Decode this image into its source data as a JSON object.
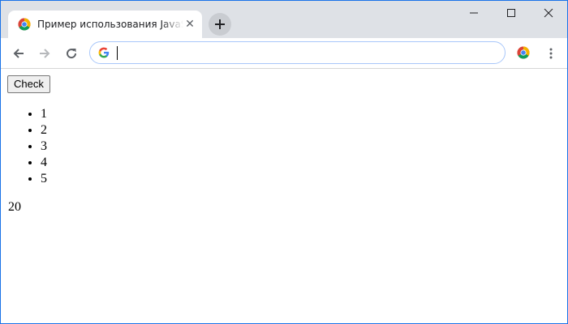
{
  "browser": {
    "tab": {
      "title": "Пример использования JavaScript",
      "favicon": "chrome-icon",
      "close_glyph": "✕"
    },
    "new_tab_glyph": "+",
    "window_controls": [
      "minimize-icon",
      "maximize-icon",
      "close-icon"
    ],
    "toolbar": {
      "back_icon": "arrow-left-icon",
      "forward_icon": "arrow-right-icon",
      "reload_icon": "reload-icon",
      "omnibox_value": "",
      "omnibox_icon": "google-g-icon",
      "extension_icon": "chrome-icon",
      "menu_icon": "kebab-menu-icon"
    },
    "colors": {
      "tabstrip": "#dee1e6",
      "accent": "#1a73e8",
      "omnibox_border": "#a8c7fa"
    }
  },
  "page": {
    "check_button_label": "Check",
    "list_items": [
      "1",
      "2",
      "3",
      "4",
      "5"
    ],
    "result": "20"
  }
}
